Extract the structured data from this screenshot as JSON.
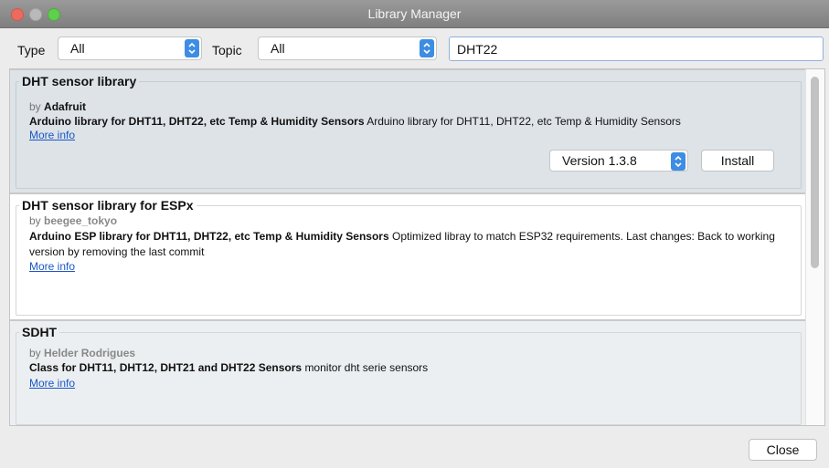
{
  "window": {
    "title": "Library Manager"
  },
  "filters": {
    "type_label": "Type",
    "type_value": "All",
    "topic_label": "Topic",
    "topic_value": "All",
    "search_value": "DHT22"
  },
  "libraries": [
    {
      "name": "DHT sensor library",
      "by_prefix": "by",
      "author": "Adafruit",
      "sentence": "Arduino library for DHT11, DHT22, etc Temp & Humidity Sensors",
      "paragraph": "Arduino library for DHT11, DHT22, etc Temp & Humidity Sensors",
      "more_info": "More info",
      "version": "Version 1.3.8",
      "install_label": "Install",
      "selected": true
    },
    {
      "name": "DHT sensor library for ESPx",
      "by_prefix": "by",
      "author": "beegee_tokyo",
      "sentence": "Arduino ESP library for DHT11, DHT22, etc Temp & Humidity Sensors",
      "paragraph": "Optimized libray to match ESP32 requirements. Last changes: Back to working version by removing the last commit",
      "more_info": "More info"
    },
    {
      "name": "SDHT",
      "by_prefix": "by",
      "author": "Helder Rodrigues",
      "sentence": "Class for DHT11, DHT12, DHT21 and DHT22 Sensors",
      "paragraph": "monitor dht serie sensors",
      "more_info": "More info"
    }
  ],
  "footer": {
    "close_label": "Close"
  },
  "colors": {
    "accent": "#3d8de3",
    "link": "#1a56c8",
    "selected_row": "#dde3e7",
    "close_light": "#ec6b5f",
    "zoom_light": "#5fcf4e"
  },
  "icons": {
    "dropdown": "up-down-chevron-icon"
  }
}
